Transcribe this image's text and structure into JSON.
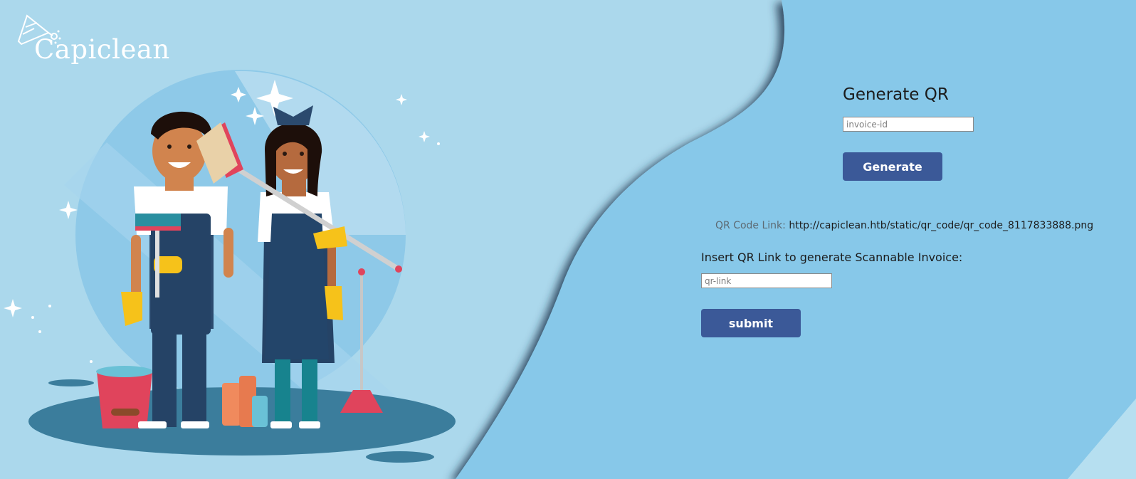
{
  "brand": {
    "name": "Capiclean"
  },
  "generator": {
    "title": "Generate QR",
    "invoice_placeholder": "invoice-id",
    "generate_label": "Generate"
  },
  "qr_result": {
    "label": "QR Code Link:",
    "link": "http://capiclean.htb/static/qr_code/qr_code_8117833888.png"
  },
  "invoice_form": {
    "instruction": "Insert QR Link to generate Scannable Invoice:",
    "qr_placeholder": "qr-link",
    "submit_label": "submit"
  },
  "colors": {
    "background_left": "#abd8ec",
    "background_right": "#87c8e9",
    "button": "#3b5998"
  }
}
